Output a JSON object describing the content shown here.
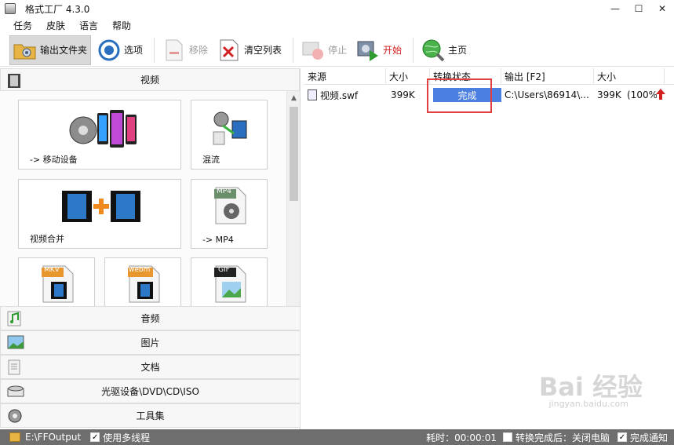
{
  "window": {
    "title": "格式工厂 4.3.0",
    "minimize": "—",
    "maximize": "☐",
    "close": "✕"
  },
  "menu": [
    "任务",
    "皮肤",
    "语言",
    "帮助"
  ],
  "toolbar": {
    "output_folder": "输出文件夹",
    "options": "选项",
    "remove": "移除",
    "clear_list": "清空列表",
    "stop": "停止",
    "start": "开始",
    "home": "主页"
  },
  "left": {
    "video_header": "视频",
    "tiles": {
      "mobile": "-> 移动设备",
      "mux": "混流",
      "merge": "视频合并",
      "mp4": "-> MP4",
      "mp4_badge": "MP4",
      "mkv_badge": "MKV",
      "webm_badge": "webm",
      "gif_badge": "GIF"
    },
    "categories": [
      "音频",
      "图片",
      "文档",
      "光驱设备\\DVD\\CD\\ISO",
      "工具集"
    ]
  },
  "tasks": {
    "columns": [
      "来源",
      "大小",
      "转换状态",
      "输出 [F2]",
      "大小"
    ],
    "rows": [
      {
        "source": "视频.swf",
        "size": "399K",
        "status": "完成",
        "status_progress": 1.0,
        "output": "C:\\Users\\86914\\...",
        "out_size": "399K",
        "ratio": "(100%)"
      }
    ]
  },
  "statusbar": {
    "output_path": "E:\\FFOutput",
    "multithread": "使用多线程",
    "elapsed": "耗时：00:00:01",
    "after_done": "转换完成后：关闭电脑",
    "notify": "完成通知"
  },
  "watermark": {
    "main": "Bai 经验",
    "sub": "jingyan.baidu.com"
  },
  "colors": {
    "status_fill": "#4b7fe0",
    "highlight": "#e04040",
    "statusbar": "#6e6e6e"
  }
}
